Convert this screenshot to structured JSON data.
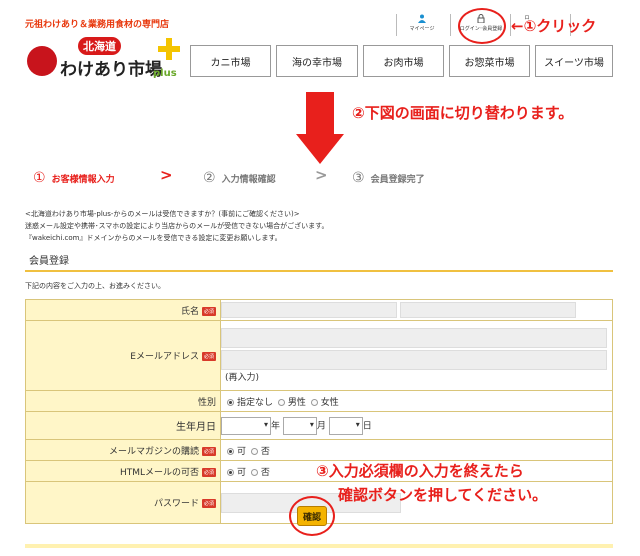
{
  "site": {
    "tagline": "元祖わけあり＆業務用食材の専門店",
    "logo_sub": "北海道",
    "logo_main": "わけあり市場",
    "logo_plus": "plus"
  },
  "top_links": [
    {
      "label": "マイページ",
      "icon": "person-icon"
    },
    {
      "label": "ログイン･会員登録",
      "icon": "lock-icon"
    },
    {
      "label": "ロ",
      "icon": "cart-icon"
    },
    {
      "label": "",
      "icon": "info-icon"
    }
  ],
  "nav": [
    "カニ市場",
    "海の幸市場",
    "お肉市場",
    "お惣菜市場",
    "スイーツ市場"
  ],
  "annotations": {
    "click": "←①クリック",
    "switch": "②下図の画面に切り替わります。",
    "fill_line1": "③入力必須欄の入力を終えたら",
    "fill_line2": "確認ボタンを押してください。"
  },
  "steps": [
    {
      "num": "①",
      "label": "お客様情報入力",
      "color": "#e8201c"
    },
    {
      "num": "②",
      "label": "入力情報確認",
      "color": "#777777"
    },
    {
      "num": "③",
      "label": "会員登録完了",
      "color": "#777777"
    }
  ],
  "step_sep": ">",
  "notice": [
    "<北海道わけあり市場-plus-からのメールは受信できますか？(事前にご確認ください)>",
    "迷惑メール設定や携帯･スマホの設定により当店からのメールが受信できない場合がございます。",
    "『wakeichi.com』ドメインからのメールを受信できる設定に変更お願いします。"
  ],
  "section_title": "会員登録",
  "intro": "下記の内容をご入力の上、お進みください。",
  "required_badge": "必須",
  "form": {
    "name_label": "氏名",
    "email_label": "Eメールアドレス",
    "email_note": "(再入力)",
    "gender_label": "性別",
    "gender_options": [
      "指定なし",
      "男性",
      "女性"
    ],
    "birth_label": "生年月日",
    "birth_units": [
      "年",
      "月",
      "日"
    ],
    "magazine_label": "メールマガジンの購読",
    "html_label": "HTMLメールの可否",
    "yes": "可",
    "no": "否",
    "password_label": "パスワード"
  },
  "confirm_button": "確認"
}
